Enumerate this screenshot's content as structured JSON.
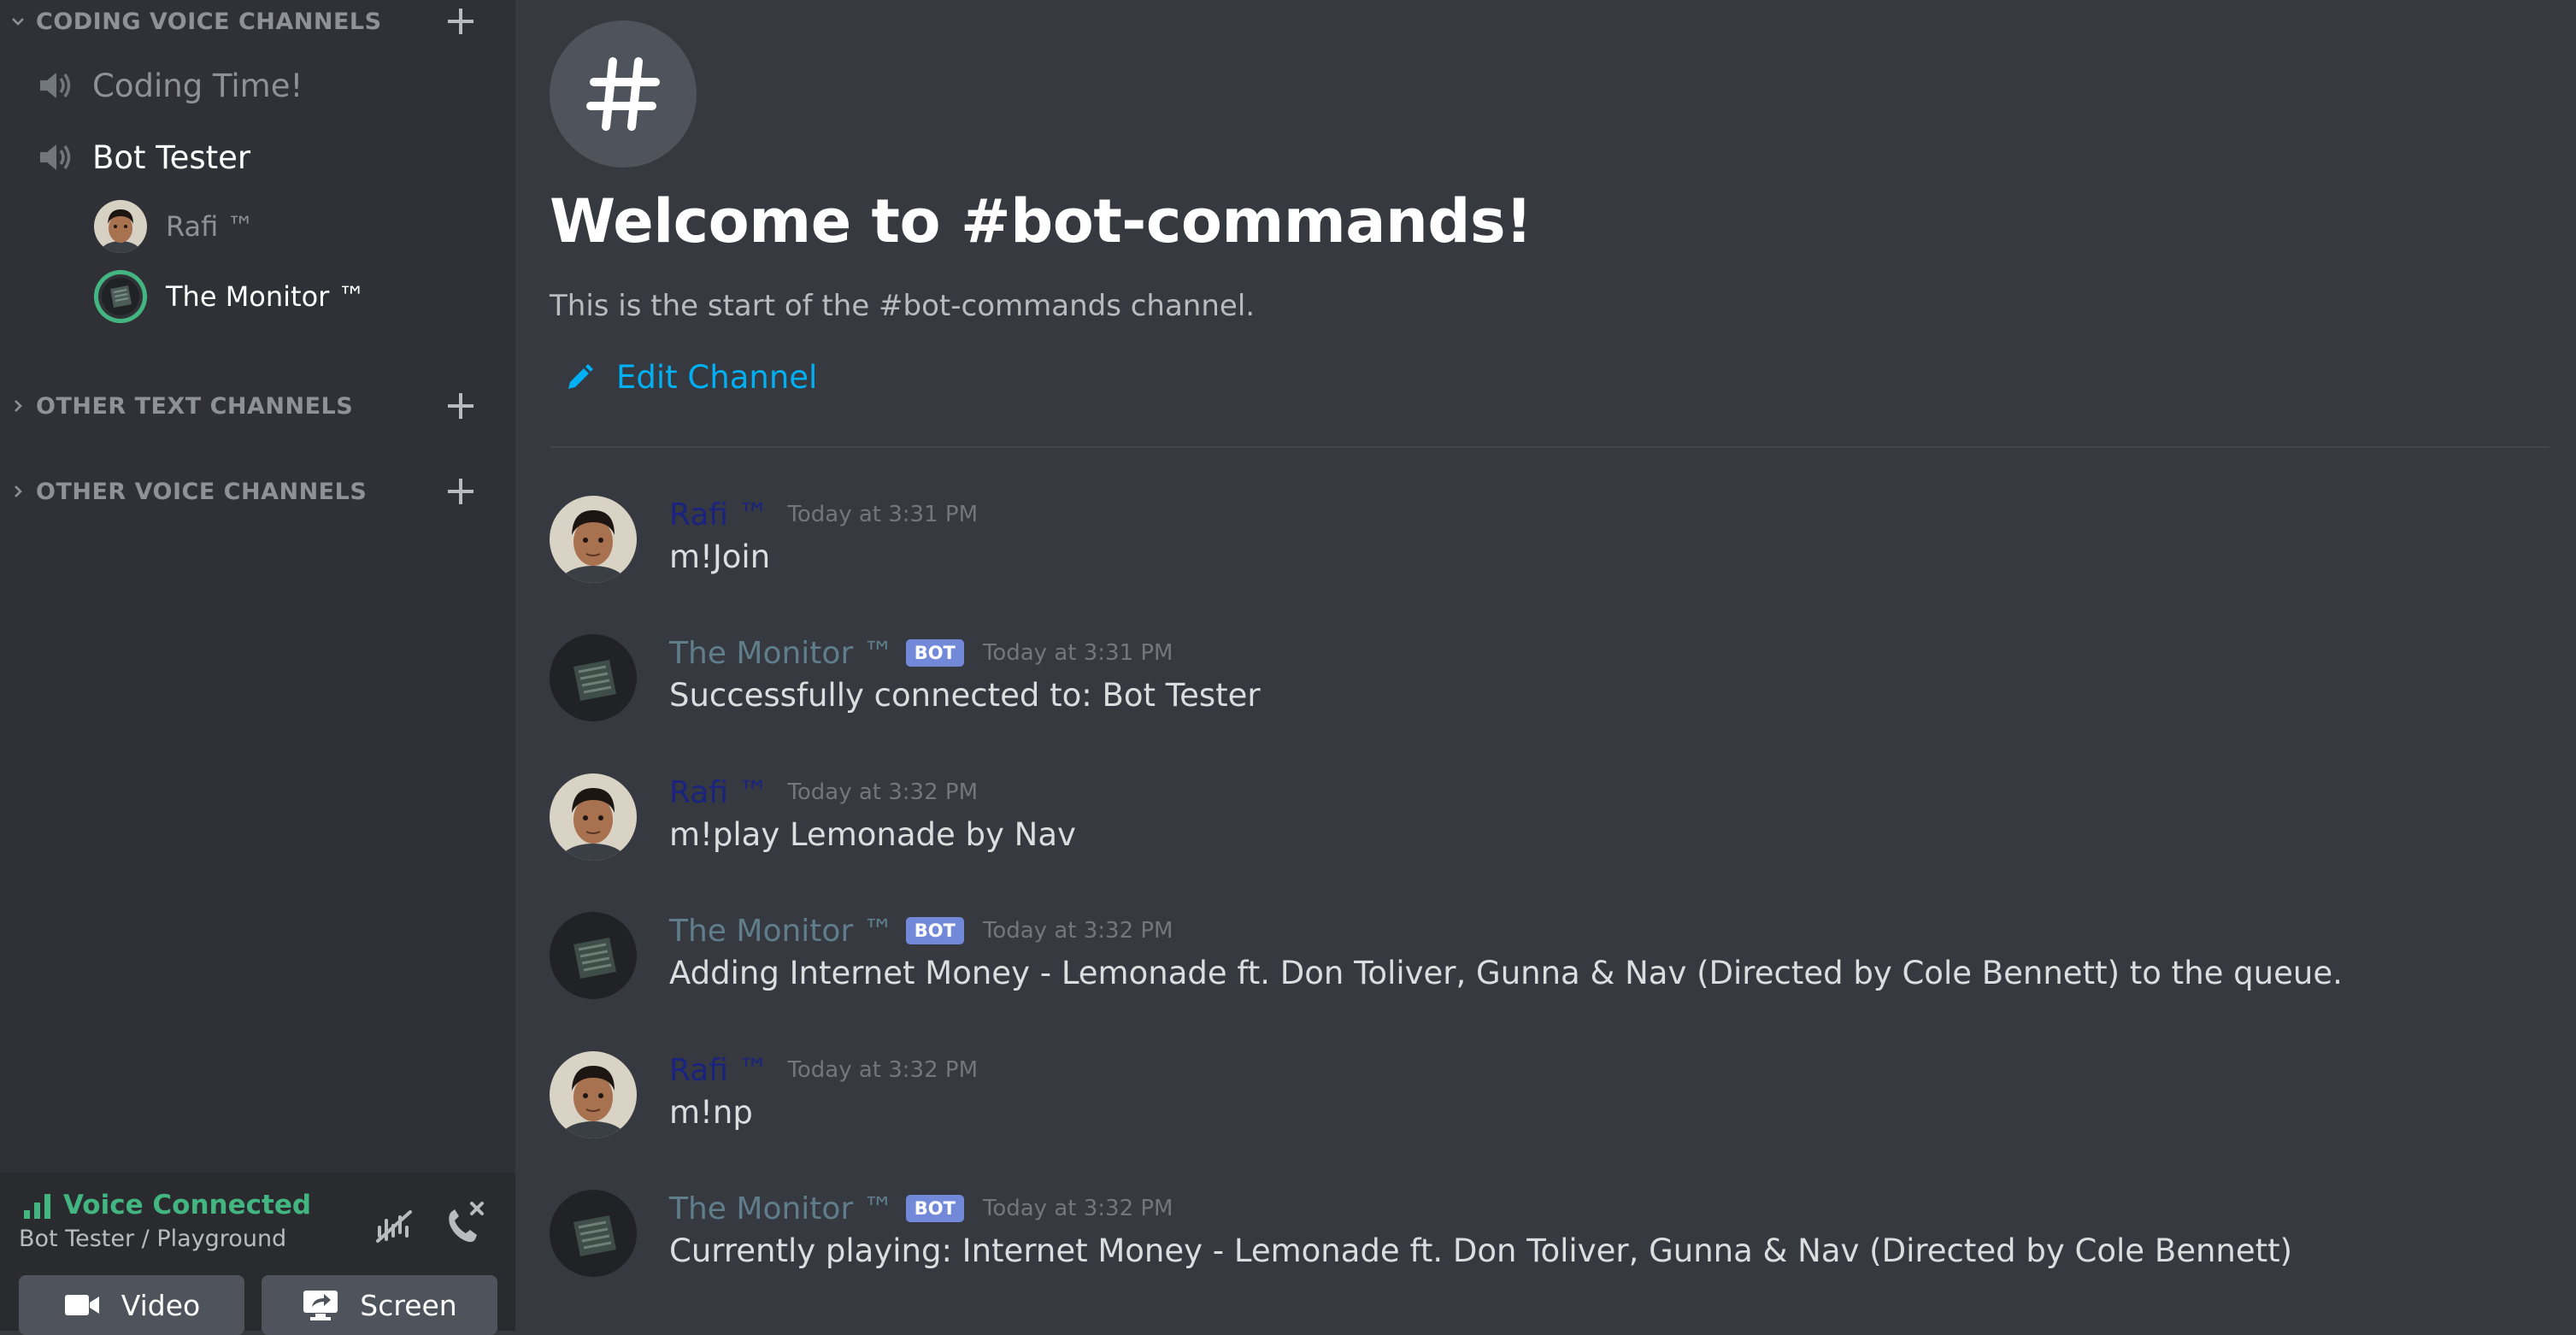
{
  "colors": {
    "sidebar_bg": "#2f3136",
    "main_bg": "#36393f",
    "voice_green": "#43b581",
    "link_blue": "#00b0f4",
    "bot_badge": "#7289da",
    "rafi_name": "#1a237e",
    "bot_name": "#607d8b"
  },
  "sidebar": {
    "coding_voice": {
      "label": "CODING VOICE CHANNELS",
      "channels": [
        {
          "name": "Coding Time!",
          "icon": "speaker-icon"
        },
        {
          "name": "Bot Tester",
          "icon": "speaker-icon"
        }
      ],
      "users": [
        {
          "name": "Rafi ™"
        },
        {
          "name": "The Monitor ™"
        }
      ]
    },
    "other_text": {
      "label": "OTHER TEXT CHANNELS"
    },
    "other_voice": {
      "label": "OTHER VOICE CHANNELS"
    }
  },
  "voice_panel": {
    "status": "Voice Connected",
    "location": "Bot Tester / Playground",
    "video_label": "Video",
    "screen_label": "Screen"
  },
  "header": {
    "welcome": "Welcome to #bot-commands!",
    "start": "This is the start of the #bot-commands channel.",
    "edit": "Edit Channel"
  },
  "bot_badge": "BOT",
  "messages": [
    {
      "author": "Rafi ™",
      "bot": false,
      "time": "Today at 3:31 PM",
      "text": "m!Join"
    },
    {
      "author": "The Monitor ™",
      "bot": true,
      "time": "Today at 3:31 PM",
      "text": "Successfully connected to: Bot Tester"
    },
    {
      "author": "Rafi ™",
      "bot": false,
      "time": "Today at 3:32 PM",
      "text": "m!play Lemonade by Nav"
    },
    {
      "author": "The Monitor ™",
      "bot": true,
      "time": "Today at 3:32 PM",
      "text": "Adding Internet Money - Lemonade ft. Don Toliver, Gunna & Nav (Directed by Cole Bennett) to the queue."
    },
    {
      "author": "Rafi ™",
      "bot": false,
      "time": "Today at 3:32 PM",
      "text": "m!np"
    },
    {
      "author": "The Monitor ™",
      "bot": true,
      "time": "Today at 3:32 PM",
      "text": "Currently playing: Internet Money - Lemonade ft. Don Toliver, Gunna & Nav (Directed by Cole Bennett)"
    }
  ]
}
